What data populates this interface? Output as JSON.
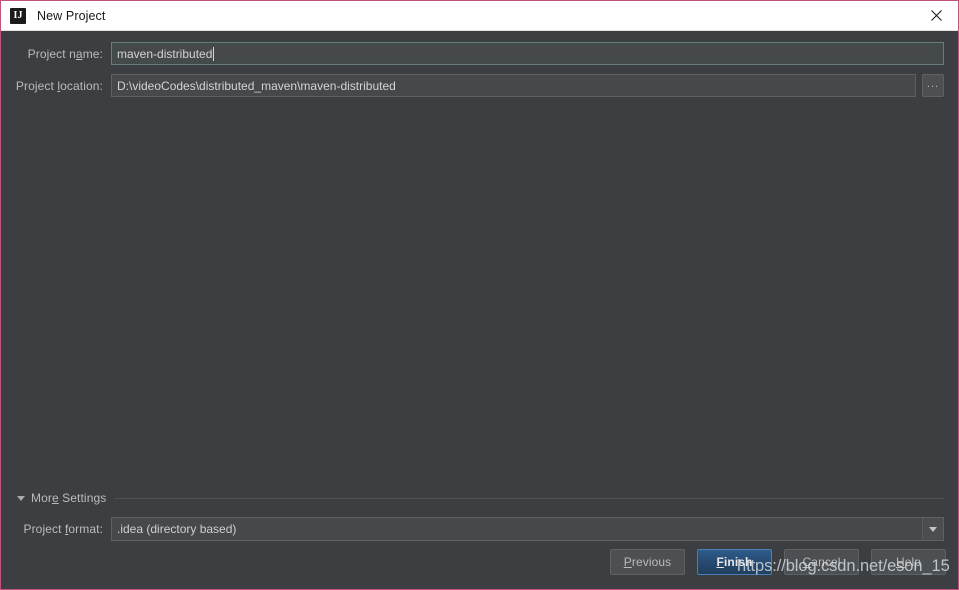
{
  "window": {
    "title": "New Project",
    "logo_text": "IJ",
    "close_icon": "close-icon",
    "border_color": "#c2517d",
    "background_color": "#3c3f41",
    "titlebar_color": "#ffffff"
  },
  "form": {
    "project_name": {
      "label_before": "Project n",
      "label_mnemonic": "a",
      "label_after": "me:",
      "value": "maven-distributed"
    },
    "project_location": {
      "label_before": "Project ",
      "label_mnemonic": "l",
      "label_after": "ocation:",
      "value": "D:\\videoCodes\\distributed_maven\\maven-distributed",
      "browse_label": "..."
    }
  },
  "more_settings": {
    "label_before": "Mor",
    "label_mnemonic": "e",
    "label_after": " Settings",
    "expanded": true,
    "triangle_icon": "chevron-down-icon"
  },
  "project_format": {
    "label_before": "Project ",
    "label_mnemonic": "f",
    "label_after": "ormat:",
    "value": ".idea (directory based)",
    "options": [
      ".idea (directory based)"
    ],
    "arrow_icon": "chevron-down-icon"
  },
  "footer": {
    "previous": {
      "before": "",
      "mnemonic": "P",
      "after": "revious"
    },
    "finish": {
      "before": "",
      "mnemonic": "F",
      "after": "inish"
    },
    "cancel": {
      "before": "",
      "mnemonic": "C",
      "after": "ancel"
    },
    "help": {
      "before": "",
      "mnemonic": "H",
      "after": "elp"
    },
    "default_button": "Finish",
    "default_color": "#2d5b8a"
  },
  "watermark": {
    "text": "https://blog.csdn.net/eson_15"
  }
}
